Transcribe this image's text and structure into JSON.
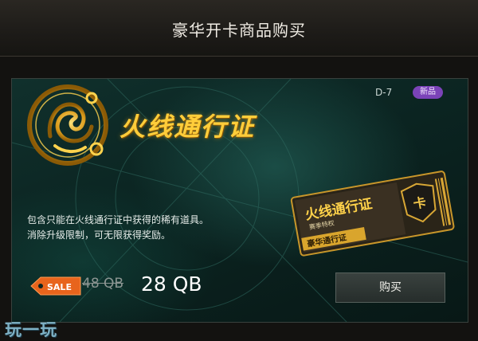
{
  "header": {
    "title": "豪华开卡商品购买"
  },
  "card": {
    "name": "火线通行证",
    "code": "D-7",
    "tag": "新品",
    "description_line1": "包含只能在火线通行证中获得的稀有道具。",
    "description_line2": "消除升级限制，可无限获得奖励。",
    "ticket": {
      "title": "火线通行证",
      "subtitle": "赛季特权",
      "band": "豪华通行证",
      "badge": "卡"
    }
  },
  "price": {
    "sale_label": "SALE",
    "original": "48 QB",
    "current": "28 QB"
  },
  "actions": {
    "buy_label": "购买"
  },
  "watermark": "玩一玩",
  "colors": {
    "gold": "#ffcd3a",
    "tag_purple": "#7b43b8",
    "sale_orange": "#e8641c",
    "card_bg": "#0b2421"
  }
}
